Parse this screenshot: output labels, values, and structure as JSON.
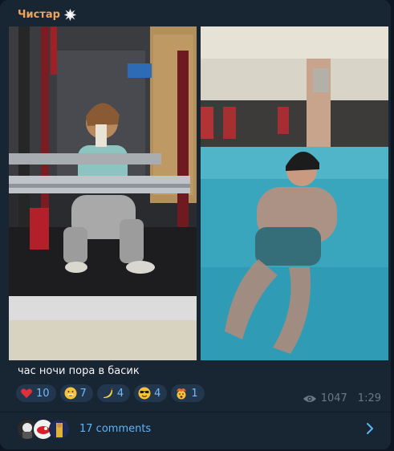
{
  "post": {
    "author": "Чистар",
    "author_badge_icon": "burst-icon",
    "caption": "час ночи пора в басик"
  },
  "reactions": [
    {
      "emoji": "red-heart",
      "count": "10"
    },
    {
      "emoji": "grinning-face",
      "count": "7"
    },
    {
      "emoji": "banana",
      "count": "4"
    },
    {
      "emoji": "smiling-face-with-sunglasses",
      "count": "4"
    },
    {
      "emoji": "exploding-head",
      "count": "1"
    }
  ],
  "meta": {
    "views": "1047",
    "time": "1:29"
  },
  "comments": {
    "label": "17 comments"
  },
  "colors": {
    "background": "#0e1621",
    "card": "#182533",
    "author": "#f0a35c",
    "accent": "#5eb5f7",
    "reaction_bg": "#22374d",
    "muted": "#6c7883"
  }
}
